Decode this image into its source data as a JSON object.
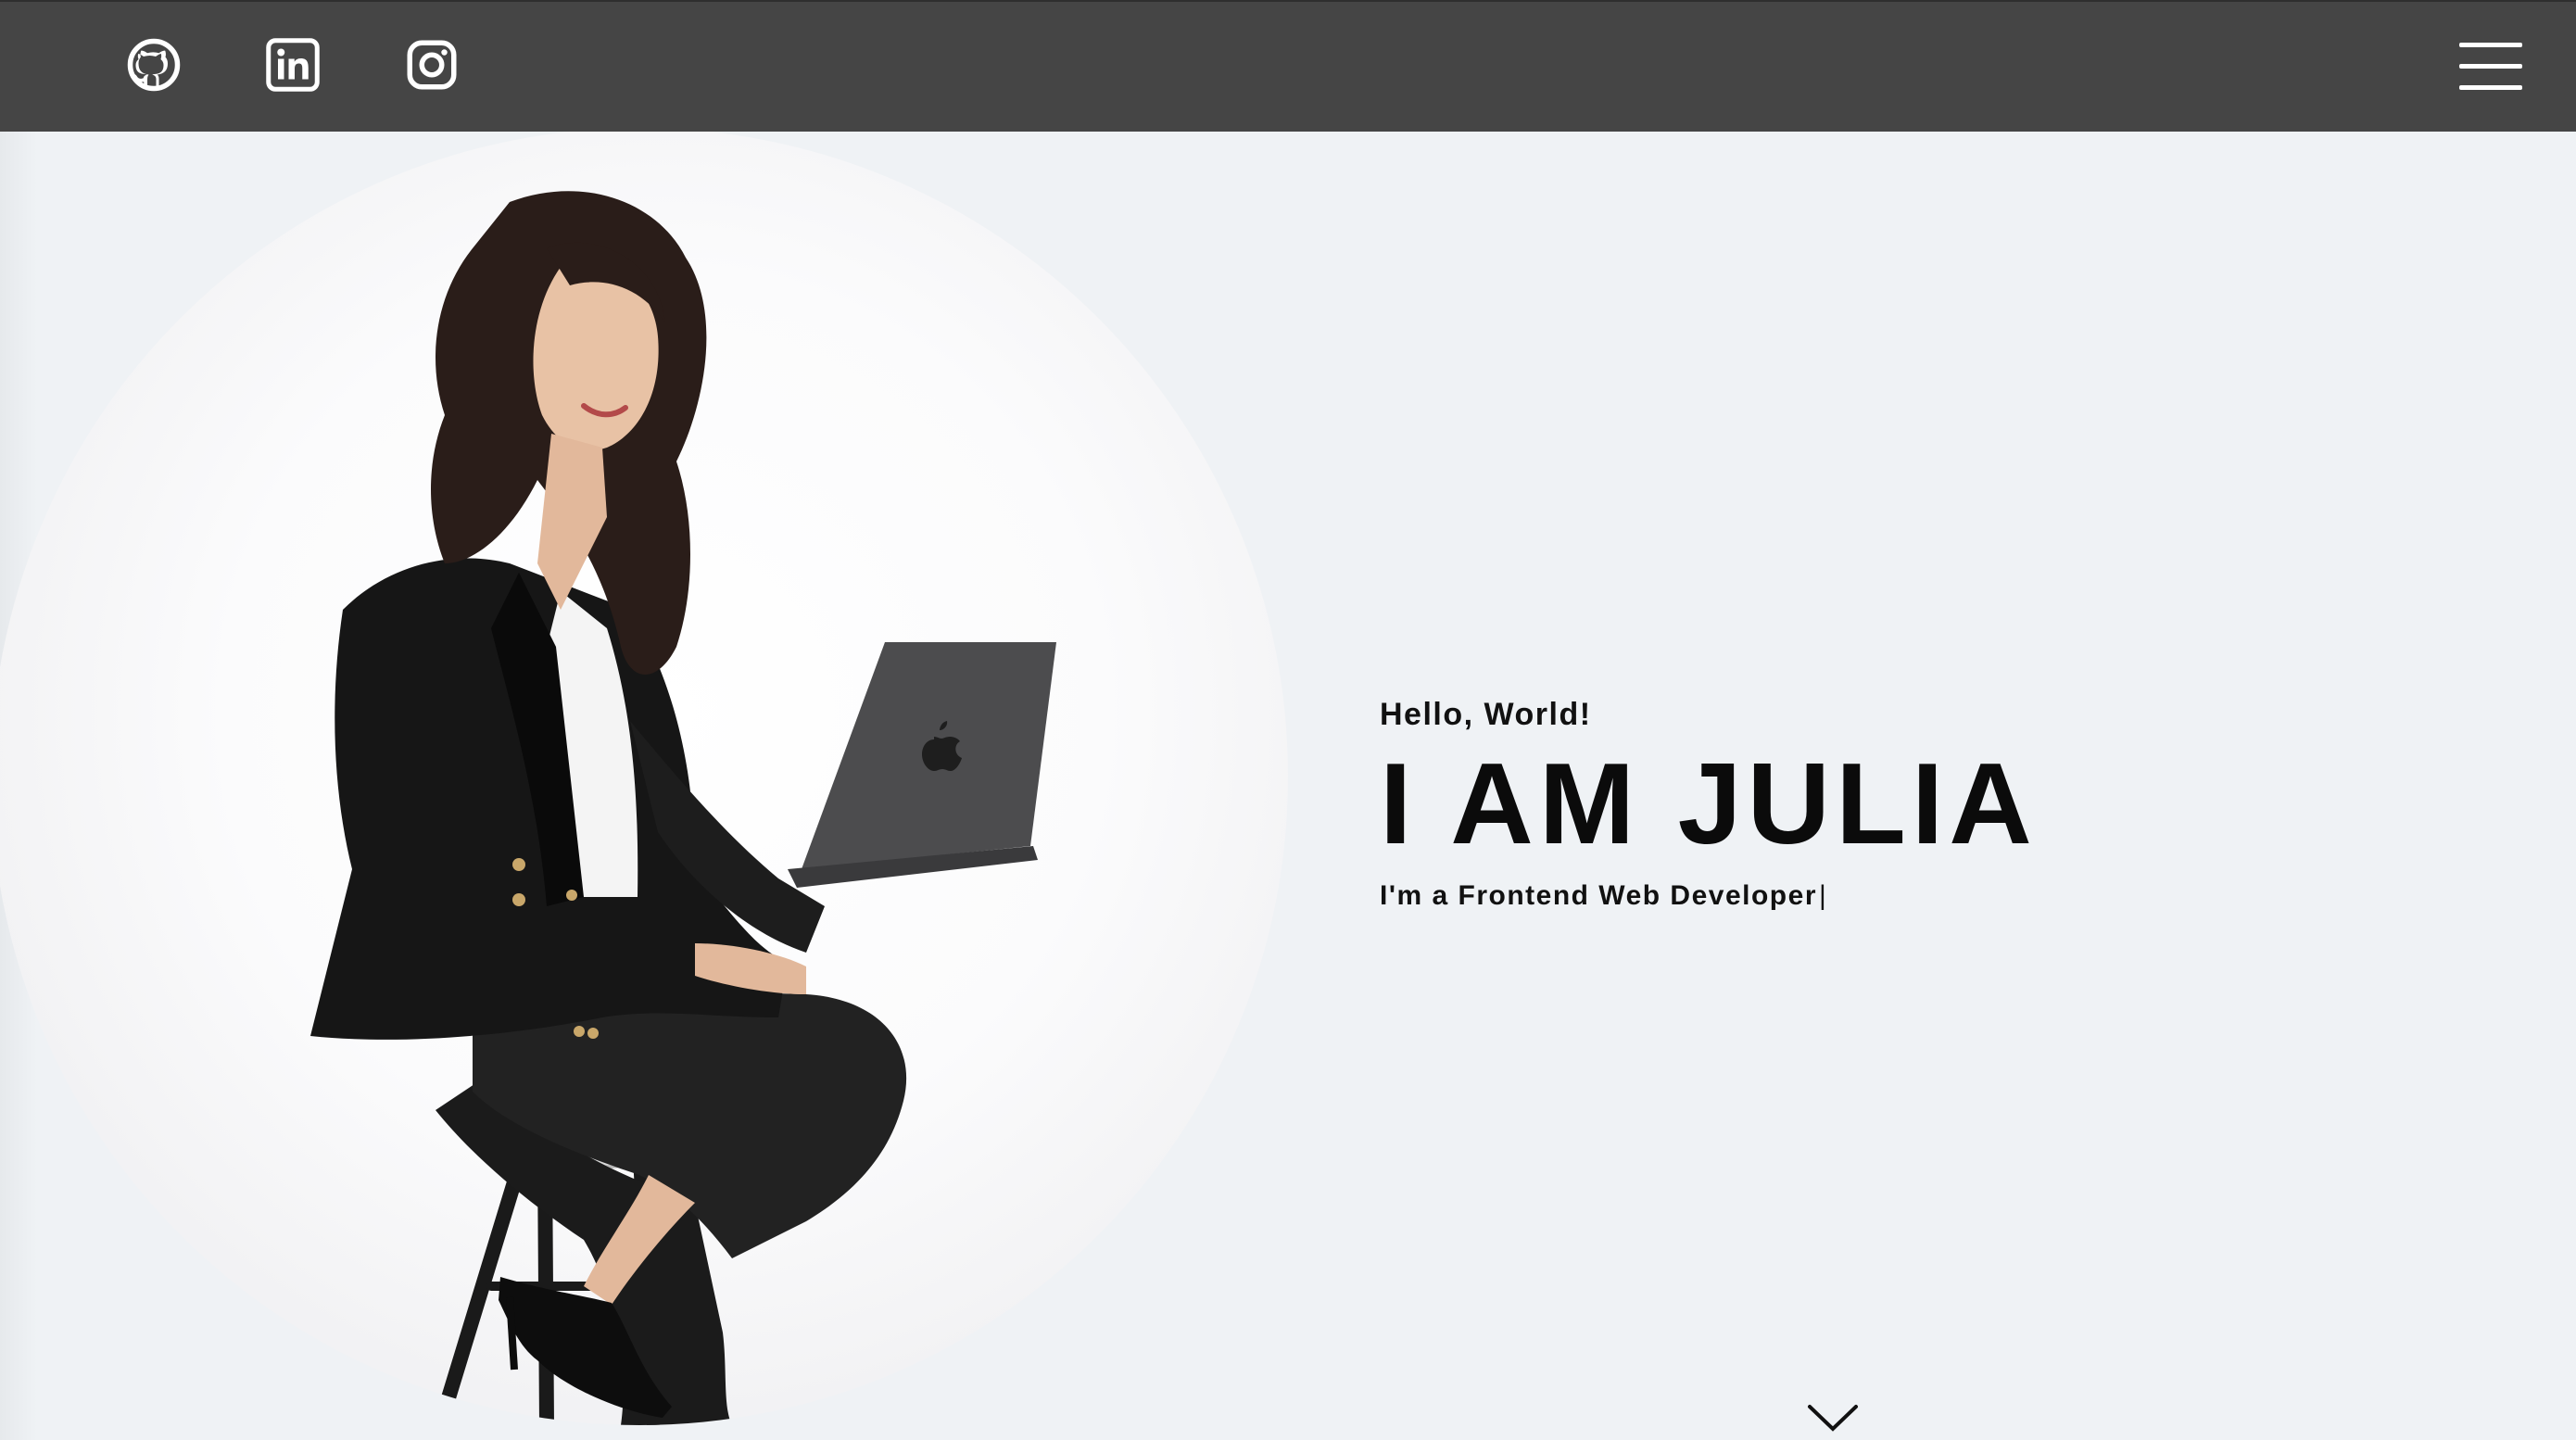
{
  "header": {
    "social_links": [
      {
        "name": "GitHub",
        "icon": "github-icon"
      },
      {
        "name": "LinkedIn",
        "icon": "linkedin-icon"
      },
      {
        "name": "Instagram",
        "icon": "instagram-icon"
      }
    ],
    "menu_icon": "hamburger-menu-icon",
    "background_color": "#454545"
  },
  "hero": {
    "greeting": "Hello, World!",
    "headline": "I AM JULIA",
    "subtitle": "I'm a Frontend Web Developer",
    "cursor": "|",
    "scroll_icon": "chevron-down-icon",
    "background_color": "#eff2f5"
  }
}
